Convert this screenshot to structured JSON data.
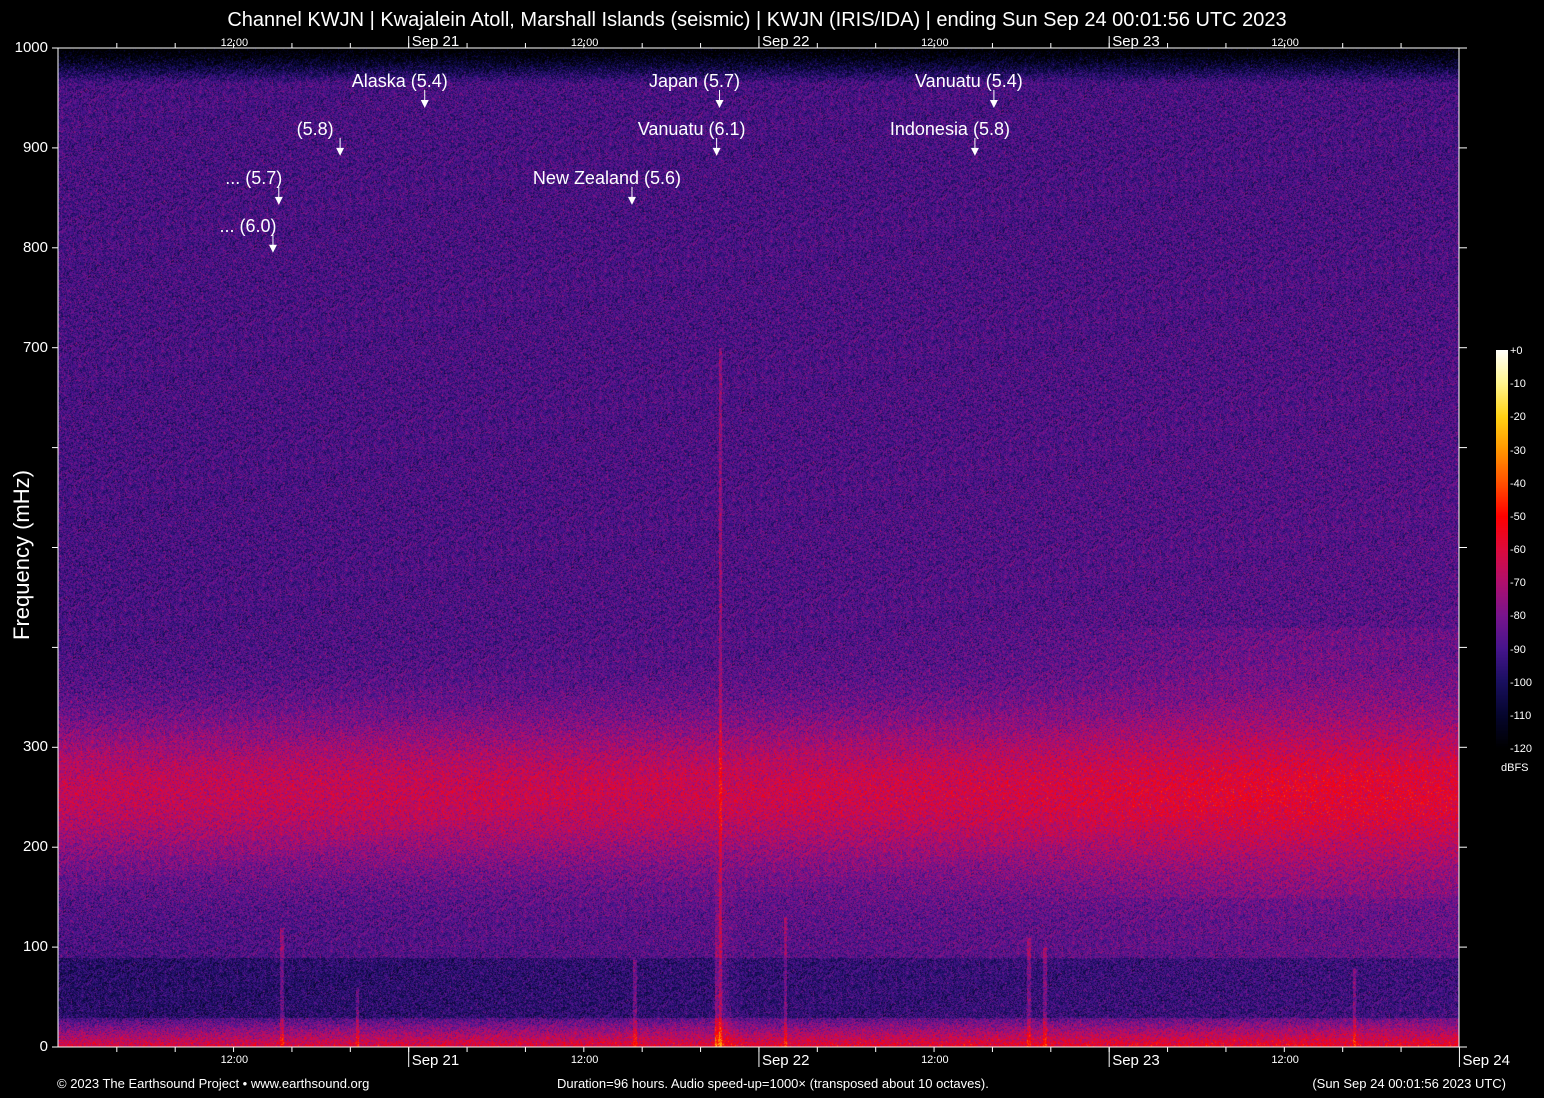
{
  "chart_data": {
    "type": "heatmap",
    "title": "Channel KWJN | Kwajalein Atoll, Marshall Islands (seismic) | KWJN (IRIS/IDA) | ending Sun Sep 24 00:01:56 UTC 2023",
    "ylabel": "Frequency (mHz)",
    "ylim": [
      0,
      1000
    ],
    "yticks": [
      0,
      100,
      200,
      300,
      400,
      500,
      600,
      700,
      800,
      900,
      1000
    ],
    "ytick_labels": [
      "0",
      "100",
      "200",
      "300",
      "",
      "",
      "",
      "700",
      "800",
      "900",
      "1000"
    ],
    "x_duration_hours": 96,
    "x_start_offset_hours_before_sep20": -0.03,
    "x_ticks": [
      {
        "hour": 12,
        "label": "12:00",
        "major": false
      },
      {
        "hour": 24,
        "label": "Sep 21",
        "major": true
      },
      {
        "hour": 36,
        "label": "12:00",
        "major": false
      },
      {
        "hour": 48,
        "label": "Sep 22",
        "major": true
      },
      {
        "hour": 60,
        "label": "12:00",
        "major": false
      },
      {
        "hour": 72,
        "label": "Sep 23",
        "major": true
      },
      {
        "hour": 84,
        "label": "12:00",
        "major": false
      },
      {
        "hour": 96,
        "label": "Sep 24",
        "major": true,
        "bottom_only": true
      }
    ],
    "minor_tick_hours": 4,
    "colorbar": {
      "unit": "dBFS",
      "min": -120,
      "max": 0,
      "tick_labels": [
        "+0",
        "-10",
        "-20",
        "-30",
        "-40",
        "-50",
        "-60",
        "-70",
        "-80",
        "-90",
        "-100",
        "-110",
        "-120"
      ]
    },
    "events": [
      {
        "label": "Alaska (5.4)",
        "hour": 25.1,
        "arrow_mhz": 940
      },
      {
        "label": "(5.8)",
        "hour": 19.3,
        "arrow_mhz": 892
      },
      {
        "label": "... (5.7)",
        "hour": 15.1,
        "arrow_mhz": 843
      },
      {
        "label": "... (6.0)",
        "hour": 14.7,
        "arrow_mhz": 795
      },
      {
        "label": "Japan (5.7)",
        "hour": 45.3,
        "arrow_mhz": 940
      },
      {
        "label": "Vanuatu (6.1)",
        "hour": 45.1,
        "arrow_mhz": 892
      },
      {
        "label": "New Zealand (5.6)",
        "hour": 39.3,
        "arrow_mhz": 843
      },
      {
        "label": "Vanuatu (5.4)",
        "hour": 64.1,
        "arrow_mhz": 940
      },
      {
        "label": "Indonesia (5.8)",
        "hour": 62.8,
        "arrow_mhz": 892
      }
    ]
  },
  "footer": {
    "left": "© 2023 The Earthsound Project • www.earthsound.org",
    "center": "Duration=96 hours. Audio speed-up=1000× (transposed about 10 octaves).",
    "right": "(Sun Sep 24 00:01:56 2023 UTC)"
  }
}
